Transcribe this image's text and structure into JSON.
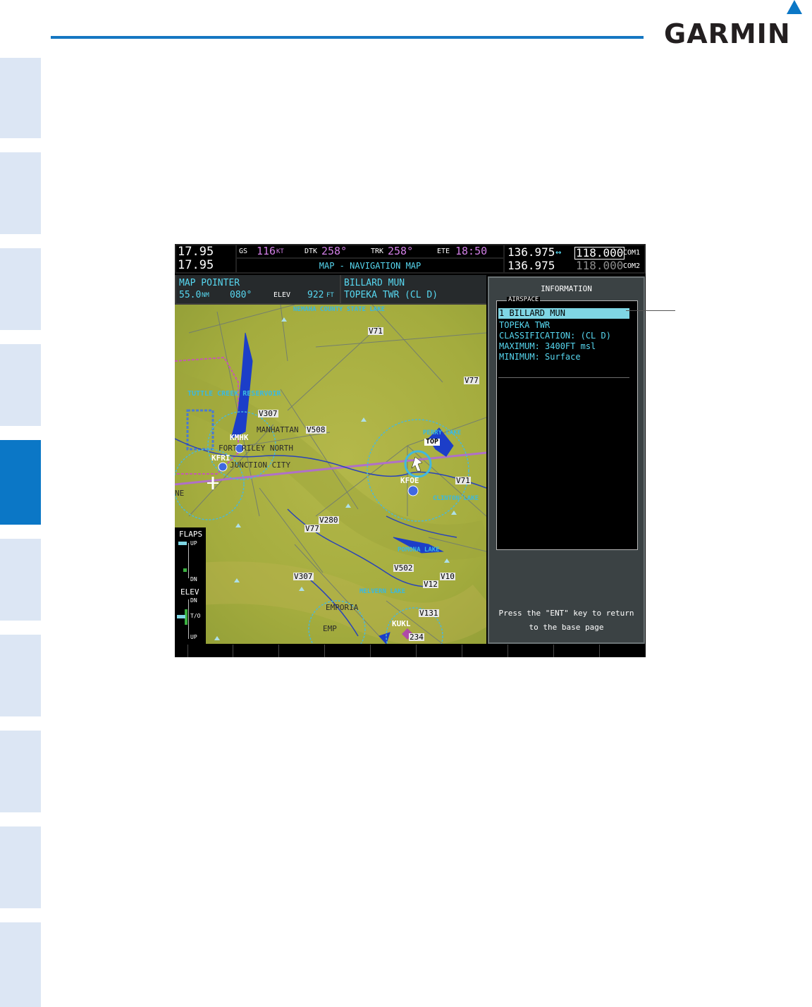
{
  "brand": "GARMIN",
  "colors": {
    "tab_active": "#0b77c6",
    "tab_inactive": "#dce6f4",
    "header_rule": "#1577c2",
    "map_green": "#a8b040",
    "airspace_cyan": "#57d7f0",
    "magenta": "#d27fe6"
  },
  "nav": {
    "nav1_active": "17.95",
    "nav2_active": "17.95",
    "gs_label": "GS",
    "gs_value": "116",
    "gs_unit": "KT",
    "dtk_label": "DTK",
    "dtk_value": "258°",
    "trk_label": "TRK",
    "trk_value": "258°",
    "ete_label": "ETE",
    "ete_value": "18:50",
    "page_title": "MAP - NAVIGATION MAP",
    "com1_standby": "136.975",
    "com1_active": "118.000",
    "com1_label": "COM1",
    "com2_standby": "136.975",
    "com2_active": "118.000",
    "com2_label": "COM2",
    "swap_icon": "↔"
  },
  "pointer": {
    "title": "MAP POINTER",
    "distance": "55.0",
    "distance_unit": "NM",
    "bearing": "080°",
    "elev_label": "ELEV",
    "elev_value": "922",
    "elev_unit": "FT",
    "airport": "BILLARD MUN",
    "airspace": "TOPEKA TWR (CL D)"
  },
  "info": {
    "title": "INFORMATION",
    "group": "AIRSPACE",
    "selected": "1 BILLARD MUN",
    "lines": [
      "TOPEKA TWR",
      "CLASSIFICATION: (CL D)",
      "MAXIMUM:  3400FT msl",
      "MINIMUM: Surface"
    ],
    "hint_line1": "Press the \"ENT\" key to return",
    "hint_line2": "to the base page"
  },
  "map": {
    "labels": {
      "nemaha": "NEMAHA COUNTY STATE LAKE",
      "tuttle": "TUTTLE CREEK RESERVOIR",
      "manhattan": "MANHATTAN",
      "fort_riley": "FORT RILEY NORTH",
      "junction": "JUNCTION CITY",
      "perry": "PERRY LAKE",
      "clinton": "CLINTON LAKE",
      "pomona": "POMONA LAKE",
      "melvern": "MELVERN LAKE",
      "emporia": "EMPORIA",
      "emp": "EMP",
      "kmhk": "KMHK",
      "kfri": "KFRI",
      "kfoe": "KFOE",
      "kukl": "KUKL",
      "top": "TOP",
      "ne": "NE"
    },
    "airways": [
      "V71",
      "V77",
      "V307",
      "V508",
      "V71",
      "V77",
      "V280",
      "V307",
      "V502",
      "V10",
      "V12",
      "V131",
      "234"
    ]
  },
  "flaps": {
    "title": "FLAPS",
    "up": "UP",
    "dn": "DN",
    "elev_title": "ELEV",
    "elev_dn": "DN",
    "elev_to": "T/O",
    "elev_up": "UP"
  }
}
